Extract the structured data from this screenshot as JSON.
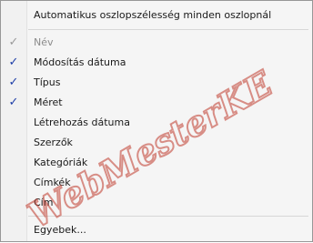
{
  "menu": {
    "top_item": {
      "label": "Automatikus oszlopszélesség minden oszlopnál"
    },
    "columns": [
      {
        "label": "Név",
        "checked": true,
        "disabled": true
      },
      {
        "label": "Módosítás dátuma",
        "checked": true,
        "disabled": false
      },
      {
        "label": "Típus",
        "checked": true,
        "disabled": false
      },
      {
        "label": "Méret",
        "checked": true,
        "disabled": false
      },
      {
        "label": "Létrehozás dátuma",
        "checked": false,
        "disabled": false
      },
      {
        "label": "Szerzők",
        "checked": false,
        "disabled": false
      },
      {
        "label": "Kategóriák",
        "checked": false,
        "disabled": false
      },
      {
        "label": "Címkék",
        "checked": false,
        "disabled": false
      },
      {
        "label": "Cím",
        "checked": false,
        "disabled": false
      }
    ],
    "more_item": {
      "label": "Egyebek..."
    },
    "check_glyph": "✓",
    "check_color": "#1e3fa8"
  },
  "watermark": {
    "text": "WebMesterKE",
    "color": "#c0392b"
  }
}
